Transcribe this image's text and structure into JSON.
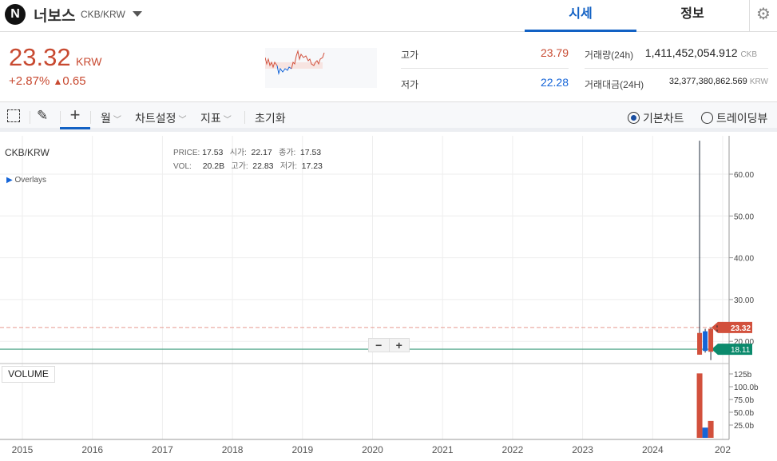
{
  "header": {
    "logo_letter": "N",
    "name": "너보스",
    "pair": "CKB/KRW",
    "tabs": [
      "시세",
      "정보"
    ]
  },
  "ticker": {
    "price": "23.32",
    "currency": "KRW",
    "change_pct": "+2.87%",
    "change_arrow": "▲",
    "change_abs": "0.65",
    "high_label": "고가",
    "high": "23.79",
    "low_label": "저가",
    "low": "22.28",
    "vol_label": "거래량(24h)",
    "vol": "1,411,452,054.912",
    "vol_unit": "CKB",
    "amt_label": "거래대금(24H)",
    "amt": "32,377,380,862.569",
    "amt_unit": "KRW"
  },
  "toolbar": {
    "period": "월",
    "settings": "차트설정",
    "indicators": "지표",
    "reset": "초기화",
    "basic_chart": "기본차트",
    "tradingview": "트레이딩뷰"
  },
  "chart_info": {
    "symbol": "CKB/KRW",
    "overlays": "Overlays",
    "price_l": "PRICE:",
    "price": "17.53",
    "open_l": "시가:",
    "open": "22.17",
    "close_l": "종가:",
    "close": "17.53",
    "vol_l": "VOL:",
    "vol": "20.2B",
    "high_l": "고가:",
    "high": "22.83",
    "low_l": "저가:",
    "low": "17.23",
    "volume_btn": "VOLUME",
    "zoom_out": "−",
    "zoom_in": "+"
  },
  "colors": {
    "up": "#d2503c",
    "down": "#1565d8",
    "accent": "#1261c4",
    "last": "#0b8a6c"
  },
  "chart_data": {
    "type": "candlestick",
    "y_ticks": [
      "60.00",
      "50.00",
      "40.00",
      "30.00",
      "20.00"
    ],
    "y_tick_values": [
      60,
      50,
      40,
      30,
      20
    ],
    "x_ticks": [
      "2015",
      "2016",
      "2017",
      "2018",
      "2019",
      "2020",
      "2021",
      "2022",
      "2023",
      "2024",
      "202"
    ],
    "vol_ticks": [
      "125b",
      "100.0b",
      "75.0b",
      "50.0b",
      "25.0b"
    ],
    "vol_tick_values": [
      125,
      100,
      75,
      50,
      25
    ],
    "current_price_label": "23.32",
    "current_price": 23.32,
    "line_label": "18.11",
    "line_value": 18.11,
    "candles": [
      {
        "t": 2024.67,
        "open": 16.8,
        "close": 22,
        "high": 68,
        "low": 16.8,
        "vol": 126
      },
      {
        "t": 2024.75,
        "open": 22.4,
        "close": 17.7,
        "high": 23,
        "low": 17.3,
        "vol": 20
      },
      {
        "t": 2024.83,
        "open": 17.5,
        "close": 23,
        "high": 23.3,
        "low": 15.5,
        "vol": 33
      },
      {
        "t": 2024.92,
        "open": 22.8,
        "close": 23.32,
        "high": 23.8,
        "low": 22.3,
        "vol": 0
      }
    ]
  }
}
